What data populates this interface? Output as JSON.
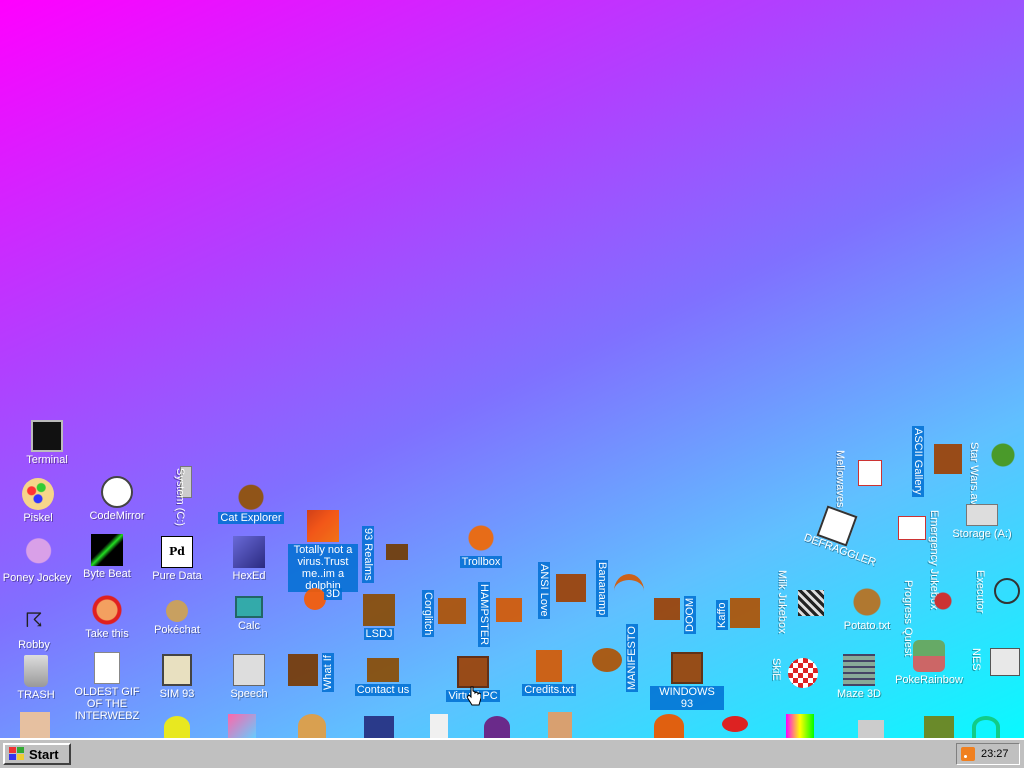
{
  "desktop": {
    "icons": [
      {
        "label": "Terminal",
        "icon": "terminal-icon",
        "selected": false
      },
      {
        "label": "Piskel",
        "icon": "palette-icon",
        "selected": false
      },
      {
        "label": "CodeMirror",
        "icon": "cat-editor-icon",
        "selected": false
      },
      {
        "label": "System (C:)",
        "icon": "tower-icon",
        "selected": false
      },
      {
        "label": "Cat Explorer",
        "icon": "cat-globe-icon",
        "selected": true
      },
      {
        "label": "Poney Jockey",
        "icon": "pony-icon",
        "selected": false
      },
      {
        "label": "Byte Beat",
        "icon": "green-wave-icon",
        "selected": false
      },
      {
        "label": "Pure Data",
        "icon": "pd-icon",
        "selected": false
      },
      {
        "label": "HexEd",
        "icon": "cube-icon",
        "selected": false
      },
      {
        "label": "Totally not a virus.Trust me..im a dolphin",
        "icon": "dolphin-icon",
        "selected": true
      },
      {
        "label": "93 Realms",
        "icon": "realms-icon",
        "selected": true
      },
      {
        "label": "Trollbox",
        "icon": "chat-icon",
        "selected": true
      },
      {
        "label": "Robby",
        "icon": "stick-figure-icon",
        "selected": false
      },
      {
        "label": "Take this",
        "icon": "troll-face-icon",
        "selected": false
      },
      {
        "label": "Pokéchat",
        "icon": "pokeball-icon",
        "selected": false
      },
      {
        "label": "Calc",
        "icon": "calculator-icon",
        "selected": false
      },
      {
        "label": "3D",
        "icon": "blob-icon",
        "selected": true
      },
      {
        "label": "LSDJ",
        "icon": "lsdj-icon",
        "selected": true
      },
      {
        "label": "Corglitch",
        "icon": "corgi-icon",
        "selected": true
      },
      {
        "label": "HAMPSTER",
        "icon": "hamster-icon",
        "selected": true
      },
      {
        "label": "ANSI Love",
        "icon": "ansi-icon",
        "selected": true
      },
      {
        "label": "Bananamp",
        "icon": "banana-icon",
        "selected": true
      },
      {
        "label": "DOOM",
        "icon": "doom-icon",
        "selected": true
      },
      {
        "label": "Kaffo",
        "icon": "kaffo-icon",
        "selected": true
      },
      {
        "label": "TRASH",
        "icon": "trash-icon",
        "selected": false
      },
      {
        "label": "OLDEST GIF OF THE INTERWEBZ",
        "icon": "gif-icon",
        "selected": false
      },
      {
        "label": "SIM 93",
        "icon": "sim-book-icon",
        "selected": false
      },
      {
        "label": "Speech",
        "icon": "speech-face-icon",
        "selected": false
      },
      {
        "label": "What If",
        "icon": "what-if-icon",
        "selected": true
      },
      {
        "label": "Contact us",
        "icon": "contact-icon",
        "selected": true
      },
      {
        "label": "Virtual PC",
        "icon": "virtual-pc-icon",
        "selected": true
      },
      {
        "label": "Credits.txt",
        "icon": "text-file-icon",
        "selected": true
      },
      {
        "label": "MANIFESTO",
        "icon": "manifesto-icon",
        "selected": true
      },
      {
        "label": "WINDOWS 93",
        "icon": "computer-icon",
        "selected": true
      },
      {
        "label": "Mellowaves",
        "icon": "mellowaves-icon",
        "selected": false
      },
      {
        "label": "ASCII Gallery",
        "icon": "ascii-gallery-icon",
        "selected": true
      },
      {
        "label": "Star Wars.avi",
        "icon": "star-wars-icon",
        "selected": false
      },
      {
        "label": "DEFRAGGLER",
        "icon": "defrag-icon",
        "selected": false
      },
      {
        "label": "Emergency Jukebox",
        "icon": "jukebox-icon",
        "selected": false
      },
      {
        "label": "Storage (A:)",
        "icon": "floppy-drive-icon",
        "selected": false
      },
      {
        "label": "Milk Jukebox",
        "icon": "milk-jukebox-icon",
        "selected": false
      },
      {
        "label": "Potato.txt",
        "icon": "potato-icon",
        "selected": false
      },
      {
        "label": "Progress Quest",
        "icon": "quest-icon",
        "selected": false
      },
      {
        "label": "Executor",
        "icon": "executor-icon",
        "selected": false
      },
      {
        "label": "SkiE",
        "icon": "amiga-ball-icon",
        "selected": false
      },
      {
        "label": "Maze 3D",
        "icon": "maze-icon",
        "selected": false
      },
      {
        "label": "PokeRainbow",
        "icon": "poke-rainbow-icon",
        "selected": false
      },
      {
        "label": "NES",
        "icon": "nes-icon",
        "selected": false
      }
    ]
  },
  "taskbar": {
    "start_label": "Start",
    "clock": "23:27"
  },
  "colors": {
    "gradient_top_left": "#ff00ff",
    "gradient_bottom_right": "#00ffff",
    "selection": "#006ed2",
    "taskbar": "#c0c0c0"
  }
}
